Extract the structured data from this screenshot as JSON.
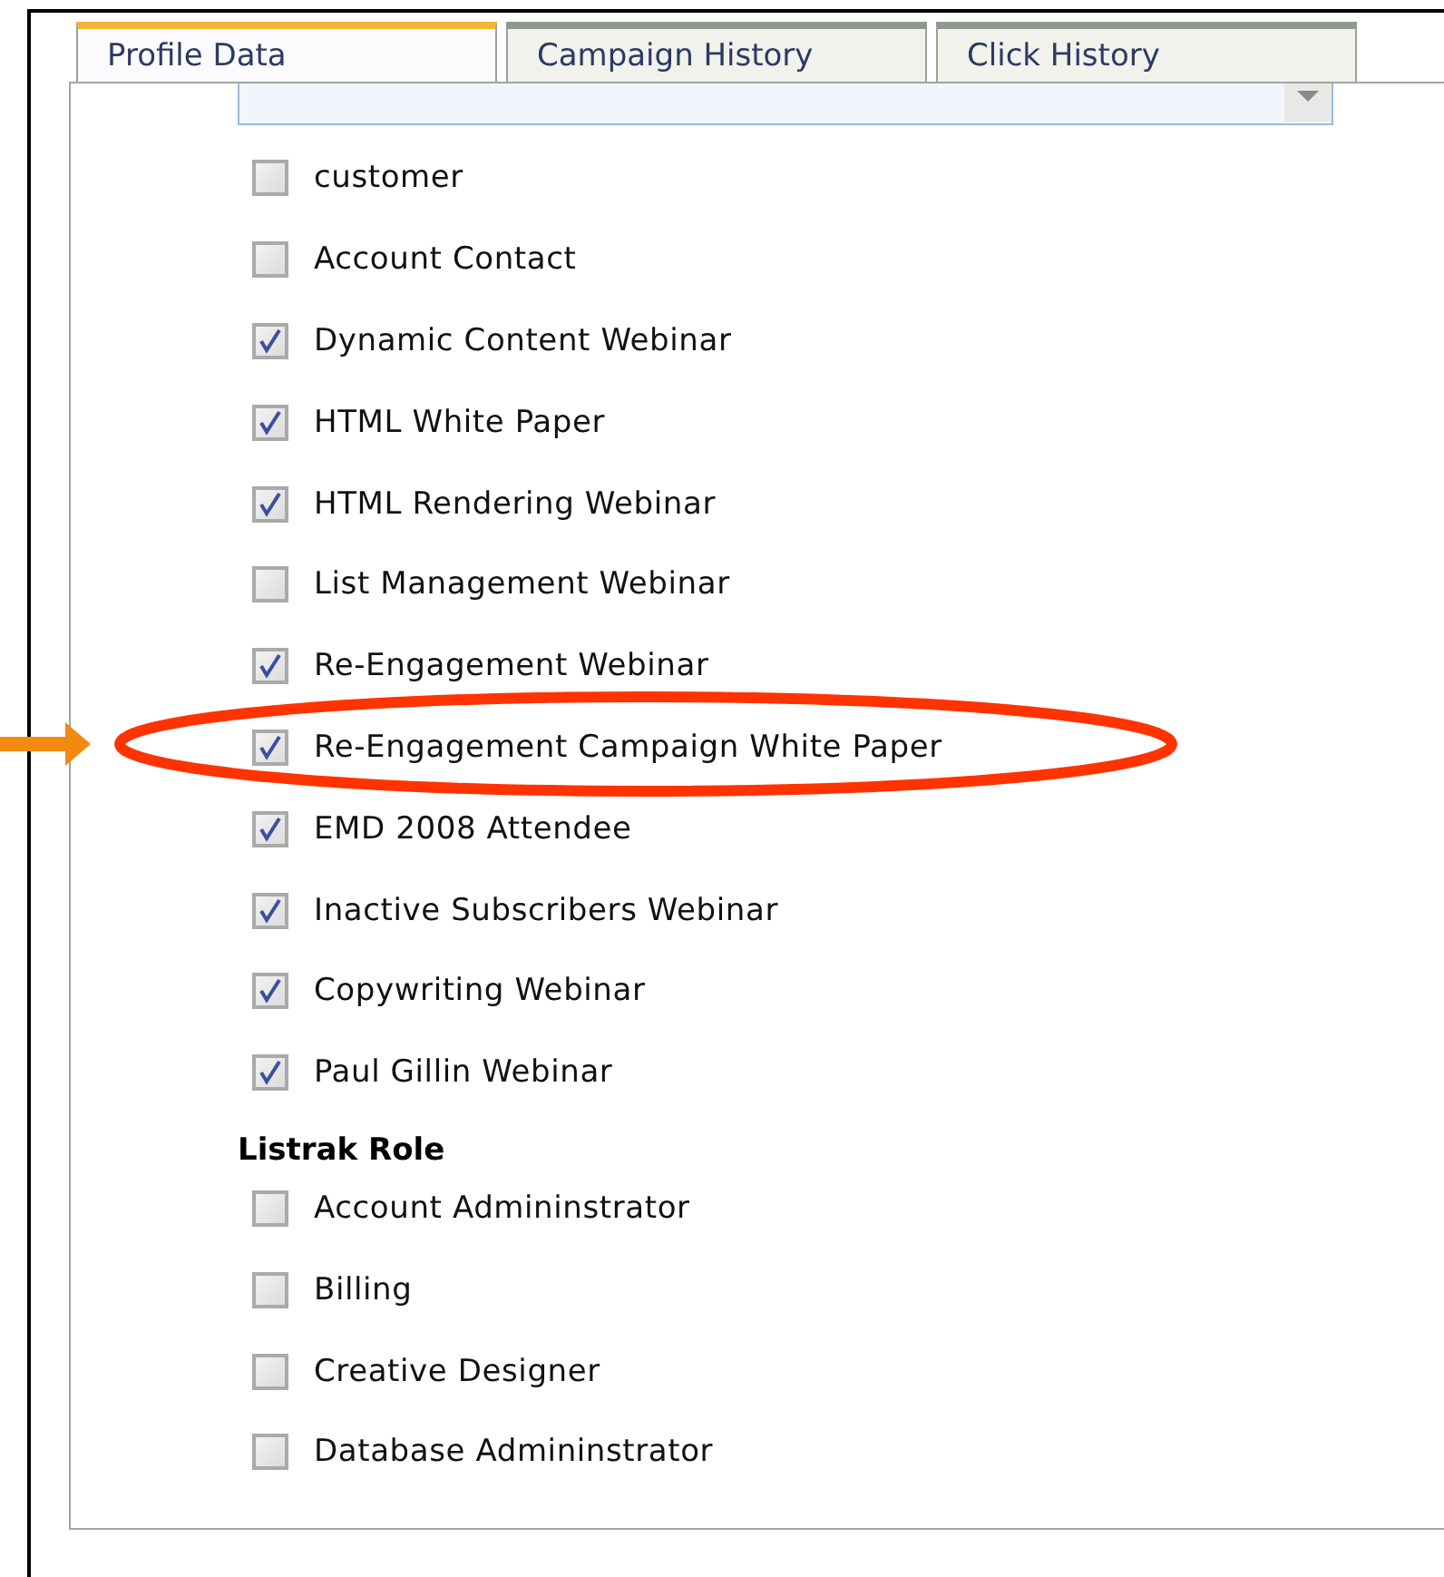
{
  "tabs": [
    {
      "label": "Profile Data",
      "selected": true
    },
    {
      "label": "Campaign History",
      "selected": false
    },
    {
      "label": "Click History",
      "selected": false
    }
  ],
  "groups": [
    {
      "items": [
        {
          "label": "customer",
          "checked": false
        },
        {
          "label": "Account Contact",
          "checked": false
        },
        {
          "label": "Dynamic Content Webinar",
          "checked": true
        },
        {
          "label": "HTML White Paper",
          "checked": true
        },
        {
          "label": "HTML Rendering Webinar",
          "checked": true
        },
        {
          "label": "List Management Webinar",
          "checked": false
        },
        {
          "label": "Re-Engagement Webinar",
          "checked": true
        },
        {
          "label": "Re-Engagement Campaign White Paper",
          "checked": true,
          "highlighted": true
        },
        {
          "label": "EMD 2008 Attendee",
          "checked": true
        },
        {
          "label": "Inactive Subscribers Webinar",
          "checked": true
        },
        {
          "label": "Copywriting Webinar",
          "checked": true
        },
        {
          "label": "Paul Gillin Webinar",
          "checked": true
        }
      ]
    },
    {
      "heading": "Listrak Role",
      "items": [
        {
          "label": "Account Admininstrator",
          "checked": false
        },
        {
          "label": "Billing",
          "checked": false
        },
        {
          "label": "Creative Designer",
          "checked": false
        },
        {
          "label": "Database Admininstrator",
          "checked": false
        }
      ]
    }
  ]
}
